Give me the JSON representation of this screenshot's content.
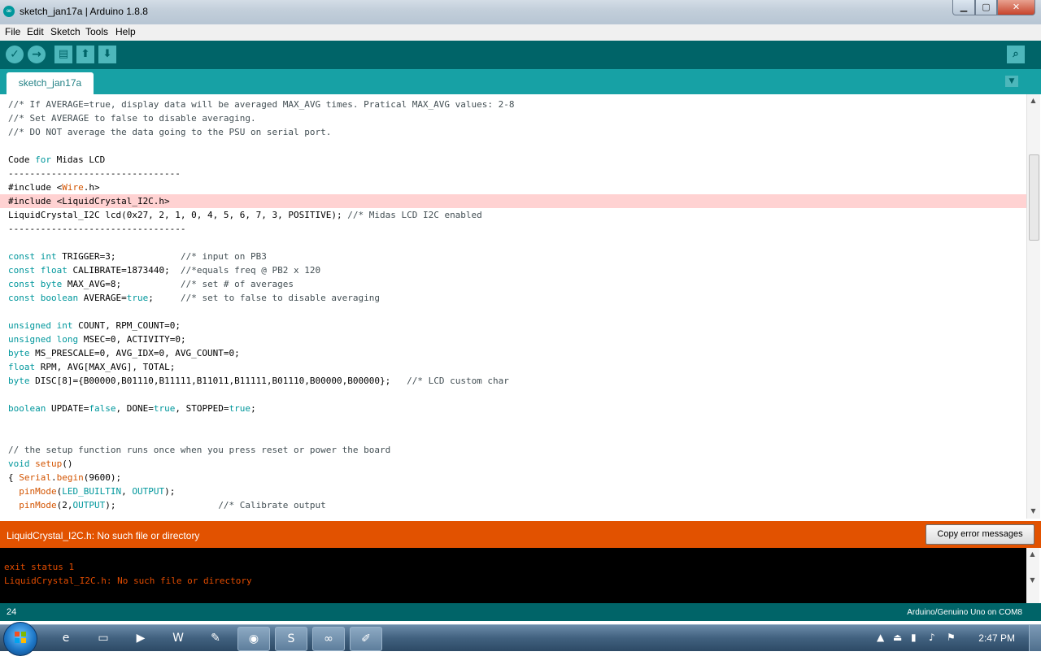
{
  "window": {
    "title": "sketch_jan17a | Arduino 1.8.8",
    "icon": "arduino-infinity-icon"
  },
  "menu": [
    "File",
    "Edit",
    "Sketch",
    "Tools",
    "Help"
  ],
  "toolbar": {
    "verify": "checkmark-icon",
    "upload": "arrow-right-icon",
    "new": "new-file-icon",
    "open": "arrow-up-icon",
    "save": "arrow-down-icon",
    "serial_monitor": "magnifier-icon"
  },
  "tabs": [
    {
      "label": "sketch_jan17a",
      "active": true
    }
  ],
  "editor": {
    "highlight_line": 7,
    "lines": [
      [
        {
          "t": "//* If AVERAGE=true, display data will be averaged MAX_AVG times. Pratical MAX_AVG values: 2-8",
          "c": "cm"
        }
      ],
      [
        {
          "t": "//* Set AVERAGE to false to disable averaging.",
          "c": "cm"
        }
      ],
      [
        {
          "t": "//* DO NOT average the data going to the PSU on serial port.",
          "c": "cm"
        }
      ],
      [],
      [
        {
          "t": "Code "
        },
        {
          "t": "for",
          "c": "kw"
        },
        {
          "t": " Midas LCD"
        }
      ],
      [
        {
          "t": "--------------------------------"
        }
      ],
      [
        {
          "t": "#include <"
        },
        {
          "t": "Wire",
          "c": "fn"
        },
        {
          "t": ".h>"
        }
      ],
      [
        {
          "t": "#include <LiquidCrystal_I2C.h>"
        }
      ],
      [
        {
          "t": "LiquidCrystal_I2C lcd(0x27, 2, 1, 0, 4, 5, 6, 7, 3, POSITIVE); "
        },
        {
          "t": "//* Midas LCD I2C enabled",
          "c": "cm"
        }
      ],
      [
        {
          "t": "---------------------------------"
        }
      ],
      [],
      [
        {
          "t": "const",
          "c": "kw"
        },
        {
          "t": " "
        },
        {
          "t": "int",
          "c": "kw"
        },
        {
          "t": " TRIGGER=3;            "
        },
        {
          "t": "//* input on PB3",
          "c": "cm"
        }
      ],
      [
        {
          "t": "const",
          "c": "kw"
        },
        {
          "t": " "
        },
        {
          "t": "float",
          "c": "kw"
        },
        {
          "t": " CALIBRATE=1873440;  "
        },
        {
          "t": "//*equals freq @ PB2 x 120",
          "c": "cm"
        }
      ],
      [
        {
          "t": "const",
          "c": "kw"
        },
        {
          "t": " "
        },
        {
          "t": "byte",
          "c": "kw"
        },
        {
          "t": " MAX_AVG=8;           "
        },
        {
          "t": "//* set # of averages",
          "c": "cm"
        }
      ],
      [
        {
          "t": "const",
          "c": "kw"
        },
        {
          "t": " "
        },
        {
          "t": "boolean",
          "c": "kw"
        },
        {
          "t": " AVERAGE="
        },
        {
          "t": "true",
          "c": "kw"
        },
        {
          "t": ";     "
        },
        {
          "t": "//* set to false to disable averaging",
          "c": "cm"
        }
      ],
      [],
      [
        {
          "t": "unsigned",
          "c": "kw"
        },
        {
          "t": " "
        },
        {
          "t": "int",
          "c": "kw"
        },
        {
          "t": " COUNT, RPM_COUNT=0;"
        }
      ],
      [
        {
          "t": "unsigned",
          "c": "kw"
        },
        {
          "t": " "
        },
        {
          "t": "long",
          "c": "kw"
        },
        {
          "t": " MSEC=0, ACTIVITY=0;"
        }
      ],
      [
        {
          "t": "byte",
          "c": "kw"
        },
        {
          "t": " MS_PRESCALE=0, AVG_IDX=0, AVG_COUNT=0;"
        }
      ],
      [
        {
          "t": "float",
          "c": "kw"
        },
        {
          "t": " RPM, AVG[MAX_AVG], TOTAL;"
        }
      ],
      [
        {
          "t": "byte",
          "c": "kw"
        },
        {
          "t": " DISC[8]={B00000,B01110,B11111,B11011,B11111,B01110,B00000,B00000};   "
        },
        {
          "t": "//* LCD custom char",
          "c": "cm"
        }
      ],
      [],
      [
        {
          "t": "boolean",
          "c": "kw"
        },
        {
          "t": " UPDATE="
        },
        {
          "t": "false",
          "c": "kw"
        },
        {
          "t": ", DONE="
        },
        {
          "t": "true",
          "c": "kw"
        },
        {
          "t": ", STOPPED="
        },
        {
          "t": "true",
          "c": "kw"
        },
        {
          "t": ";"
        }
      ],
      [],
      [],
      [
        {
          "t": "// the setup function runs once when you press reset or power the board",
          "c": "cm"
        }
      ],
      [
        {
          "t": "void",
          "c": "kw"
        },
        {
          "t": " "
        },
        {
          "t": "setup",
          "c": "fn"
        },
        {
          "t": "()"
        }
      ],
      [
        {
          "t": "{ "
        },
        {
          "t": "Serial",
          "c": "fn"
        },
        {
          "t": "."
        },
        {
          "t": "begin",
          "c": "fn"
        },
        {
          "t": "(9600);"
        }
      ],
      [
        {
          "t": "  "
        },
        {
          "t": "pinMode",
          "c": "fn"
        },
        {
          "t": "("
        },
        {
          "t": "LED_BUILTIN",
          "c": "kw"
        },
        {
          "t": ", "
        },
        {
          "t": "OUTPUT",
          "c": "kw"
        },
        {
          "t": ");"
        }
      ],
      [
        {
          "t": "  "
        },
        {
          "t": "pinMode",
          "c": "fn"
        },
        {
          "t": "(2,"
        },
        {
          "t": "OUTPUT",
          "c": "kw"
        },
        {
          "t": ");                   "
        },
        {
          "t": "//* Calibrate output",
          "c": "cm"
        }
      ]
    ]
  },
  "error_bar": {
    "message": "LiquidCrystal_I2C.h: No such file or directory",
    "copy_button": "Copy error messages"
  },
  "console": {
    "lines": [
      "exit status 1",
      "LiquidCrystal_I2C.h: No such file or directory"
    ]
  },
  "status": {
    "line_number": "24",
    "board": "Arduino/Genuino Uno on COM8"
  },
  "taskbar": {
    "items": [
      "internet-explorer-icon",
      "file-explorer-icon",
      "media-player-icon",
      "word-icon",
      "paint-icon",
      "chrome-icon",
      "skype-icon",
      "arduino-icon",
      "paint-brush-icon"
    ],
    "clock": "2:47 PM"
  }
}
